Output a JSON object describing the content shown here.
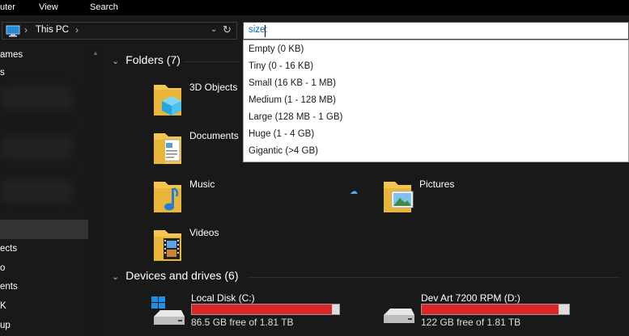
{
  "ribbon": {
    "tabs": [
      "uter",
      "View",
      "Search"
    ]
  },
  "address": {
    "crumb": "This PC",
    "separator": "›"
  },
  "search": {
    "query": "size:"
  },
  "dropdown": {
    "options": [
      "Empty (0 KB)",
      "Tiny (0 - 16 KB)",
      "Small (16 KB - 1 MB)",
      "Medium (1 - 128 MB)",
      "Large (128 MB - 1 GB)",
      "Huge (1 - 4 GB)",
      "Gigantic (>4 GB)"
    ]
  },
  "nav": {
    "items": [
      "ames",
      "s",
      "ects",
      "o",
      "ents",
      "K",
      "up"
    ]
  },
  "groups": {
    "folders_title": "Folders (7)",
    "drives_title": "Devices and drives (6)"
  },
  "folders": [
    {
      "name": "3D Objects",
      "icon": "3d-objects-folder-icon"
    },
    {
      "name": "Documents",
      "icon": "documents-folder-icon"
    },
    {
      "name": "Music",
      "icon": "music-folder-icon"
    },
    {
      "name": "Pictures",
      "icon": "pictures-folder-icon"
    },
    {
      "name": "Videos",
      "icon": "videos-folder-icon"
    }
  ],
  "drives": [
    {
      "name": "Local Disk (C:)",
      "free": "86.5 GB free of 1.81 TB",
      "used_fraction": 0.95,
      "icon": "windows-drive-icon"
    },
    {
      "name": "Dev Art 7200 RPM (D:)",
      "free": "122 GB free of 1.81 TB",
      "used_fraction": 0.93,
      "icon": "hard-drive-icon"
    }
  ],
  "colors": {
    "background": "#191919",
    "ribbon": "#000000",
    "drive_bar_fill": "#da2626",
    "search_query": "#0060c0",
    "folder_yellow": "#f4c64e",
    "cloud": "#5aa8f0"
  }
}
